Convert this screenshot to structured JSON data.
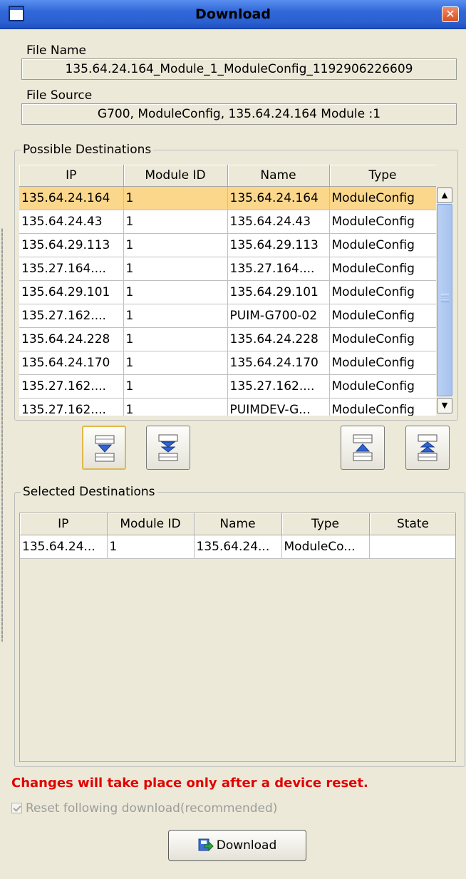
{
  "window": {
    "title": "Download"
  },
  "file_name": {
    "label": "File Name",
    "value": "135.64.24.164_Module_1_ModuleConfig_1192906226609"
  },
  "file_source": {
    "label": "File Source",
    "value": "G700, ModuleConfig, 135.64.24.164 Module :1"
  },
  "possible": {
    "label": "Possible Destinations",
    "columns": [
      "IP",
      "Module ID",
      "Name",
      "Type"
    ],
    "rows": [
      [
        "135.64.24.164",
        "1",
        "135.64.24.164",
        "ModuleConfig"
      ],
      [
        "135.64.24.43",
        "1",
        "135.64.24.43",
        "ModuleConfig"
      ],
      [
        "135.64.29.113",
        "1",
        "135.64.29.113",
        "ModuleConfig"
      ],
      [
        "135.27.164....",
        "1",
        "135.27.164....",
        "ModuleConfig"
      ],
      [
        "135.64.29.101",
        "1",
        "135.64.29.101",
        "ModuleConfig"
      ],
      [
        "135.27.162....",
        "1",
        "PUIM-G700-02",
        "ModuleConfig"
      ],
      [
        "135.64.24.228",
        "1",
        "135.64.24.228",
        "ModuleConfig"
      ],
      [
        "135.64.24.170",
        "1",
        "135.64.24.170",
        "ModuleConfig"
      ],
      [
        "135.27.162....",
        "1",
        "135.27.162....",
        "ModuleConfig"
      ],
      [
        "135.27.162....",
        "1",
        "PUIMDEV-G...",
        "ModuleConfig"
      ]
    ]
  },
  "selected": {
    "label": "Selected Destinations",
    "columns": [
      "IP",
      "Module ID",
      "Name",
      "Type",
      "State"
    ],
    "rows": [
      [
        "135.64.24...",
        "1",
        "135.64.24...",
        "ModuleCo...",
        ""
      ]
    ]
  },
  "move_buttons": [
    "add-selected-icon",
    "add-all-icon",
    "remove-selected-icon",
    "remove-all-icon"
  ],
  "warning": "Changes will take place only after a device reset.",
  "reset_checkbox": {
    "label": "Reset following download(recommended)",
    "checked": true,
    "enabled": false
  },
  "download_button": {
    "label": "Download"
  },
  "colors": {
    "warning": "#e10000",
    "selection": "#fbd78c",
    "titlebar": "#3168d8"
  }
}
